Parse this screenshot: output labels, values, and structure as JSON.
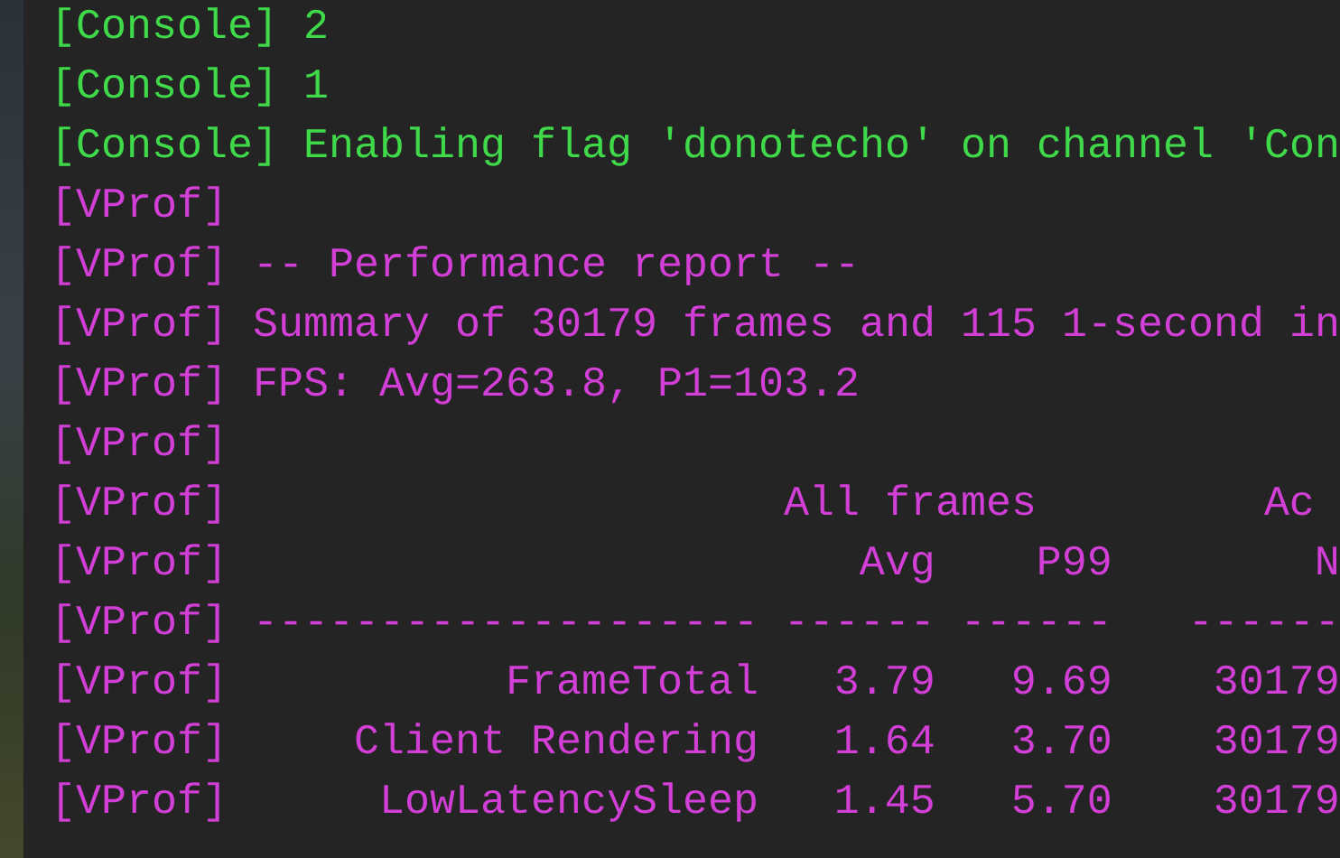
{
  "console": {
    "lines": [
      {
        "kind": "log",
        "color": "#3fd94a",
        "tag": "[Console]",
        "text": "2"
      },
      {
        "kind": "log",
        "color": "#3fd94a",
        "tag": "[Console]",
        "text": "1"
      },
      {
        "kind": "log",
        "color": "#3fd94a",
        "tag": "[Console]",
        "text": "Enabling flag 'donotecho' on channel 'Con"
      },
      {
        "kind": "log",
        "color": "#d23fd6",
        "tag": "[VProf]"
      },
      {
        "kind": "log",
        "color": "#d23fd6",
        "tag": "[VProf]",
        "text": "-- Performance report --"
      },
      {
        "kind": "log",
        "color": "#d23fd6",
        "tag": "[VProf]",
        "text": "Summary of 30179 frames and 115 1-second in"
      },
      {
        "kind": "log",
        "color": "#d23fd6",
        "tag": "[VProf]",
        "text": "FPS: Avg=263.8, P1=103.2"
      },
      {
        "kind": "log",
        "color": "#d23fd6",
        "tag": "[VProf]"
      },
      {
        "kind": "group_header",
        "color": "#d23fd6",
        "tag": "[VProf]",
        "groups": [
          "All frames",
          "Ac"
        ]
      },
      {
        "kind": "column_header",
        "color": "#d23fd6",
        "tag": "[VProf]",
        "cells": [
          "",
          "Avg",
          "P99",
          "N"
        ]
      },
      {
        "kind": "separator",
        "color": "#d23fd6",
        "tag": "[VProf]",
        "cells": [
          "--------------------",
          "------",
          "------",
          "------"
        ]
      },
      {
        "kind": "row",
        "color": "#d23fd6",
        "tag": "[VProf]",
        "cells": [
          "FrameTotal",
          "3.79",
          "9.69",
          "30179"
        ]
      },
      {
        "kind": "row",
        "color": "#d23fd6",
        "tag": "[VProf]",
        "cells": [
          "Client Rendering",
          "1.64",
          "3.70",
          "30179"
        ]
      },
      {
        "kind": "row",
        "color": "#d23fd6",
        "tag": "[VProf]",
        "cells": [
          "LowLatencySleep",
          "1.45",
          "5.70",
          "30179"
        ]
      }
    ]
  }
}
